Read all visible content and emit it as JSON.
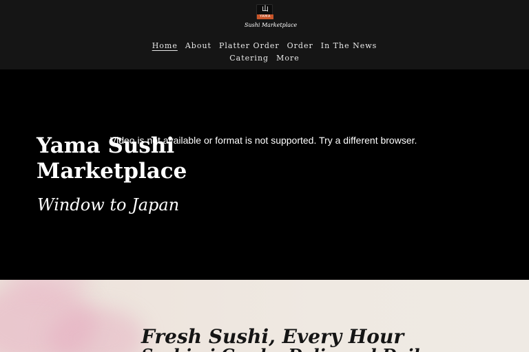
{
  "header": {
    "logo": {
      "glyph": "山",
      "band_text": "YAMA",
      "script_text": "Sushi Marketplace"
    },
    "nav": {
      "row1": [
        {
          "label": "Home",
          "active": true
        },
        {
          "label": "About",
          "active": false
        },
        {
          "label": "Platter Order",
          "active": false
        },
        {
          "label": "Order",
          "active": false
        },
        {
          "label": "In The News",
          "active": false
        }
      ],
      "row2": [
        {
          "label": "Catering",
          "active": false
        },
        {
          "label": "More",
          "active": false
        }
      ]
    }
  },
  "hero": {
    "video_message": "Video is not available or format is not supported. Try a different browser.",
    "title": "Yama Sushi Marketplace",
    "subtitle": "Window to Japan"
  },
  "fresh": {
    "title": "Fresh Sushi, Every Hour",
    "subtitle": "Sashimi Grade, Delivered Daily"
  },
  "colors": {
    "header_bg": "#151515",
    "hero_bg": "#000000",
    "logo_accent": "#c8552a",
    "section_bg": "#efe9e2",
    "pink_wash": "#e7b0c3"
  }
}
